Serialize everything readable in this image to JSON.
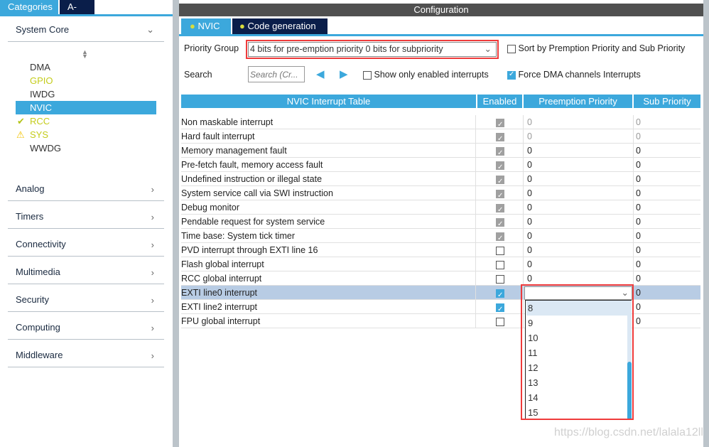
{
  "left": {
    "tabs": [
      "Categories",
      "A->Z"
    ],
    "system_core": "System Core",
    "items": [
      {
        "label": "DMA",
        "color": "#333333",
        "icon": ""
      },
      {
        "label": "GPIO",
        "color": "#c4cc1a",
        "icon": ""
      },
      {
        "label": "IWDG",
        "color": "#333333",
        "icon": ""
      },
      {
        "label": "NVIC",
        "color": "#ffffff",
        "icon": "",
        "selected": true
      },
      {
        "label": "RCC",
        "color": "#c4cc1a",
        "icon": "check-icon"
      },
      {
        "label": "SYS",
        "color": "#c4cc1a",
        "icon": "warning-icon"
      },
      {
        "label": "WWDG",
        "color": "#333333",
        "icon": ""
      }
    ],
    "categories": [
      "Analog",
      "Timers",
      "Connectivity",
      "Multimedia",
      "Security",
      "Computing",
      "Middleware"
    ]
  },
  "config": {
    "title": "Configuration",
    "tabs": [
      "NVIC",
      "Code generation"
    ],
    "priority_group_label": "Priority Group",
    "priority_group_value": "4 bits for pre-emption priority 0 bits for subpriority",
    "sort_label": "Sort by Premption Priority and Sub Priority",
    "search_label": "Search",
    "search_placeholder": "Search (Cr...",
    "show_enabled_label": "Show only enabled interrupts",
    "force_dma_label": "Force DMA channels Interrupts",
    "force_dma_checked": true,
    "columns": [
      "NVIC Interrupt Table",
      "Enabled",
      "Preemption Priority",
      "Sub Priority"
    ],
    "rows": [
      {
        "name": "Non maskable interrupt",
        "enabled": "disabled-checked",
        "pre": "0",
        "sub": "0",
        "grey": true
      },
      {
        "name": "Hard fault interrupt",
        "enabled": "disabled-checked",
        "pre": "0",
        "sub": "0",
        "grey": true
      },
      {
        "name": "Memory management fault",
        "enabled": "disabled-checked",
        "pre": "0",
        "sub": "0"
      },
      {
        "name": "Pre-fetch fault, memory access fault",
        "enabled": "disabled-checked",
        "pre": "0",
        "sub": "0"
      },
      {
        "name": "Undefined instruction or illegal state",
        "enabled": "disabled-checked",
        "pre": "0",
        "sub": "0"
      },
      {
        "name": "System service call via SWI instruction",
        "enabled": "disabled-checked",
        "pre": "0",
        "sub": "0"
      },
      {
        "name": "Debug monitor",
        "enabled": "disabled-checked",
        "pre": "0",
        "sub": "0"
      },
      {
        "name": "Pendable request for system service",
        "enabled": "disabled-checked",
        "pre": "0",
        "sub": "0"
      },
      {
        "name": "Time base: System tick timer",
        "enabled": "disabled-checked",
        "pre": "0",
        "sub": "0"
      },
      {
        "name": "PVD interrupt through EXTI line 16",
        "enabled": "off",
        "pre": "0",
        "sub": "0"
      },
      {
        "name": "Flash global interrupt",
        "enabled": "off",
        "pre": "0",
        "sub": "0"
      },
      {
        "name": "RCC global interrupt",
        "enabled": "off",
        "pre": "0",
        "sub": "0"
      },
      {
        "name": "EXTI line0 interrupt",
        "enabled": "on",
        "pre": "",
        "sub": "0",
        "selected": true
      },
      {
        "name": "EXTI line2 interrupt",
        "enabled": "on",
        "pre": "0",
        "sub": "0"
      },
      {
        "name": "FPU global interrupt",
        "enabled": "off",
        "pre": "0",
        "sub": "0"
      }
    ],
    "dropdown_options": [
      "8",
      "9",
      "10",
      "11",
      "12",
      "13",
      "14",
      "15"
    ],
    "dropdown_highlighted": "8"
  },
  "watermark": "https://blog.csdn.net/lalala12ll",
  "colors": {
    "accent": "#3ca8dc",
    "navy": "#0a1e4a",
    "highlight": "#ef3b3b",
    "selected_row": "#b8cce4"
  }
}
